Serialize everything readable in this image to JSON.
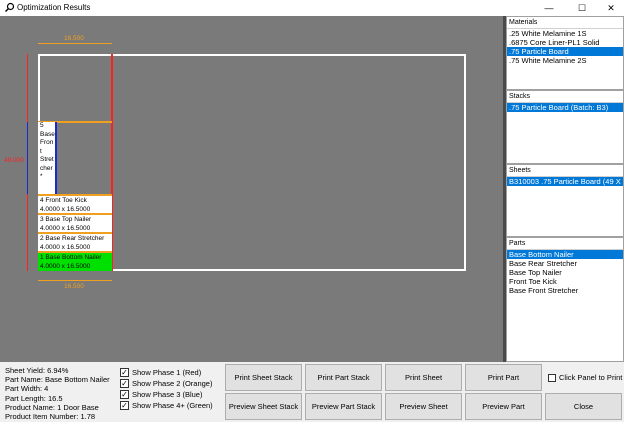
{
  "window": {
    "title": "Optimization Results",
    "minimize": "—",
    "maximize": "☐",
    "close": "✕"
  },
  "canvas": {
    "top_dim": "16.500",
    "bottom_dim": "16.500",
    "side_dim": "49.000",
    "parts": [
      {
        "name": "4 Front Toe Kick",
        "dim": "4.0000 x 16.5000"
      },
      {
        "name": "3 Base Top Nailer",
        "dim": "4.0000 x 16.5000"
      },
      {
        "name": "2 Base Rear Stretcher",
        "dim": "4.0000 x 16.5000"
      },
      {
        "name": "1 Base Bottom Nailer",
        "dim": "4.0000 x 16.5000"
      }
    ],
    "vertical_part": [
      "5",
      "Base",
      "Fron",
      "t",
      "Stret",
      "cher",
      "*"
    ]
  },
  "materials": {
    "header": "Materials",
    "items": [
      ".25 White Melamine 1S",
      ".6875 Core Liner-PL1 Solid",
      ".75 Particle Board",
      ".75 White Melamine 2S"
    ],
    "selected": 2
  },
  "stacks": {
    "header": "Stacks",
    "items": [
      ".75 Particle Board (Batch: B3)"
    ]
  },
  "sheets": {
    "header": "Sheets",
    "items": [
      "B310003 .75 Particle Board (49 X"
    ]
  },
  "parts_list": {
    "header": "Parts",
    "items": [
      "Base Bottom Nailer",
      "Base Rear Stretcher",
      "Base Top Nailer",
      "Front Toe Kick",
      "Base Front Stretcher"
    ]
  },
  "info": {
    "sheet_yield": "Sheet Yield:  6.94%",
    "part_name": "Part Name:  Base Bottom Nailer",
    "part_width": "Part Width:  4",
    "part_length": "Part Length:  16.5",
    "product_name": "Product Name:  1 Door Base",
    "product_item": "Product Item Number:  1.78"
  },
  "phases": [
    "Show Phase 1 (Red)",
    "Show Phase 2 (Orange)",
    "Show Phase 3 (Blue)",
    "Show Phase 4+ (Green)"
  ],
  "buttons": {
    "print_sheet_stack": "Print Sheet Stack",
    "print_part_stack": "Print Part Stack",
    "print_sheet": "Print Sheet",
    "print_part": "Print Part",
    "preview_sheet_stack": "Preview Sheet Stack",
    "preview_part_stack": "Preview Part Stack",
    "preview_sheet": "Preview Sheet",
    "preview_part": "Preview Part",
    "close": "Close",
    "click_panel": "Click Panel to Print"
  },
  "colors": {
    "phase1": "#ff2020",
    "phase2": "#f0a020",
    "phase3": "#1a2acc",
    "phase4": "#00e000",
    "selection": "#0078d7"
  }
}
